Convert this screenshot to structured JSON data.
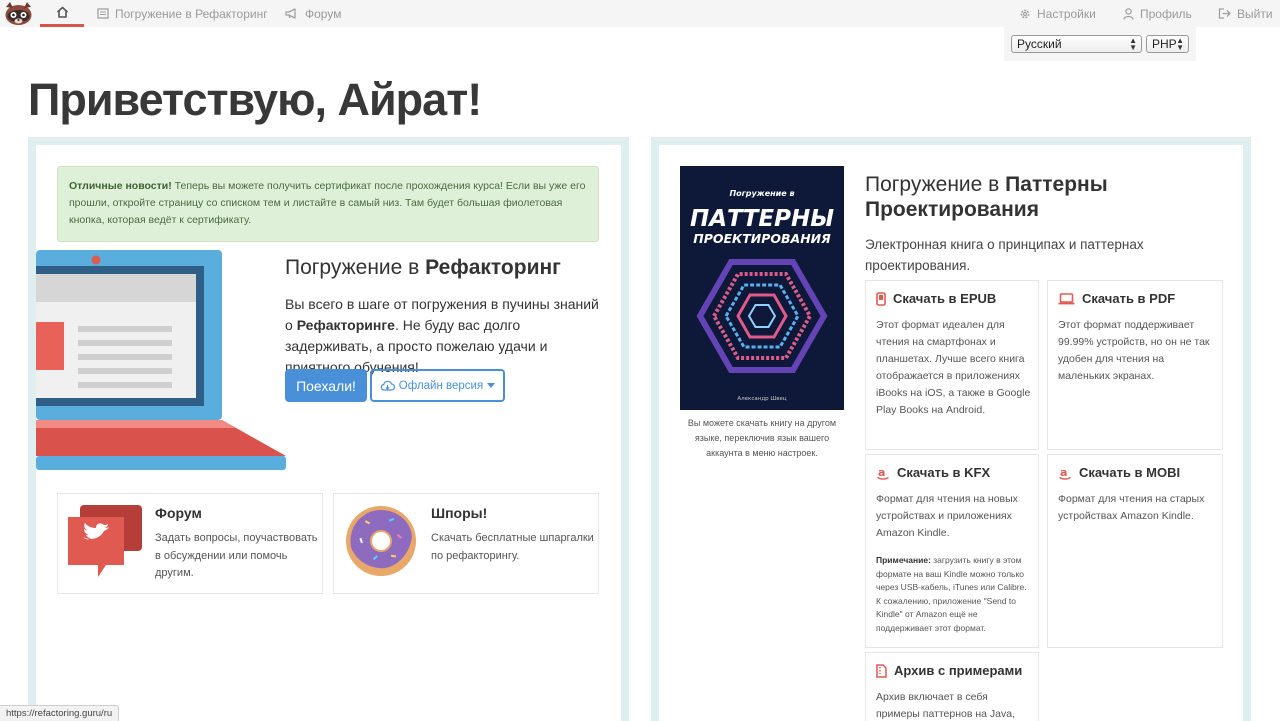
{
  "nav": {
    "items": [
      {
        "label": "Погружение в Рефакторинг",
        "icon": "book-icon"
      },
      {
        "label": "Форум",
        "icon": "megaphone-icon"
      }
    ],
    "settings_label": "Настройки",
    "profile_label": "Профиль",
    "logout_label": "Выйти",
    "language_value": "Русский",
    "code_language_value": "PHP"
  },
  "page_title": "Приветствую, Айрат!",
  "alert": {
    "bold": "Отличные новости!",
    "text": " Теперь вы можете получить сертификат после прохождения курса! Если вы уже его прошли, откройте страницу со списком тем и листайте в самый низ. Там будет большая фиолетовая кнопка, которая ведёт к сертификату."
  },
  "course": {
    "title_prefix": "Погружение в ",
    "title_bold": "Рефакторинг",
    "desc_1": "Вы всего в шаге от погружения в пучины знаний о ",
    "desc_bold": "Рефакторинге",
    "desc_2": ". Не буду вас долго задерживать, а просто пожелаю удачи и приятного обучения!",
    "go_button": "Поехали!",
    "offline_button": "Офлайн версия"
  },
  "cards": {
    "forum": {
      "title": "Форум",
      "text": "Задать вопросы, поучаствовать в обсуждении или помочь другим."
    },
    "tips": {
      "title": "Шпоры!",
      "text": "Скачать бесплатные шпаргалки по рефакторингу."
    }
  },
  "book": {
    "cover_top": "Погружение в",
    "cover_line1": "ПАТТЕРНЫ",
    "cover_line2": "ПРОЕКТИРОВАНИЯ",
    "cover_author": "Александр Швец",
    "caption": "Вы можете скачать книгу на другом языке, переключив язык вашего аккаунта в меню настроек.",
    "title_prefix": "Погружение в ",
    "title_bold": "Паттерны Проектирования",
    "desc": "Электронная книга о принципах и паттернах проектирования."
  },
  "formats": {
    "epub": {
      "title": "Скачать в EPUB",
      "text": "Этот формат идеален для чтения на смартфонах и планшетах. Лучше всего книга отображается в приложениях iBooks на iOS, а также в Google Play Books на Android."
    },
    "pdf": {
      "title": "Скачать в PDF",
      "text": "Этот формат поддерживает 99.99% устройств, но он не так удобен для чтения на маленьких экранах."
    },
    "kfx": {
      "title": "Скачать в KFX",
      "text": "Формат для чтения на новых устройствах и приложениях Amazon Kindle.",
      "note_bold": "Примечание:",
      "note": " загрузить книгу в этом формате на ваш Kindle можно только через USB-кабель, iTunes или Calibre. К сожалению, приложение \"Send to Kindle\" от Amazon ещё не поддерживает этот формат."
    },
    "mobi": {
      "title": "Скачать в MOBI",
      "text": "Формат для чтения на старых устройствах Amazon Kindle."
    },
    "archive": {
      "title": "Архив с примерами",
      "text": "Архив включает в себя примеры паттернов на Java,"
    }
  },
  "status_url": "https://refactoring.guru/ru",
  "colors": {
    "accent": "#4a90d9",
    "alert_bg": "#dff0d8",
    "panel_border": "#dfeeee",
    "active_tab": "#d9534f",
    "amazon": "#d9534f"
  }
}
